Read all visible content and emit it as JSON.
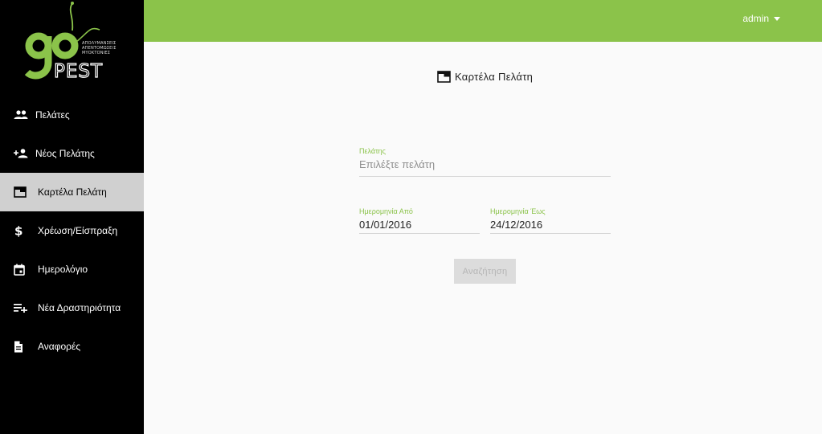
{
  "brand": {
    "logo_name": "go",
    "logo_subtitle_lines": [
      "ΑΠΟΛΥΜΑΝΣΕΙΣ",
      "ΑΠΕΝΤΟΜΩΣΕΙΣ",
      "ΜΥΟΚΤΟΝΙΕΣ"
    ],
    "logo_pest": "PEST",
    "accent_color": "#8bc34a"
  },
  "header": {
    "user_name": "admin"
  },
  "sidebar": {
    "items": [
      {
        "label": "Πελάτες",
        "icon": "people-icon"
      },
      {
        "label": "Νέος Πελάτης",
        "icon": "person-add-icon"
      },
      {
        "label": "Καρτέλα Πελάτη",
        "icon": "tab-card-icon",
        "active": true
      },
      {
        "label": "Χρέωση/Είσπραξη",
        "icon": "dollar-icon"
      },
      {
        "label": "Ημερολόγιο",
        "icon": "calendar-icon"
      },
      {
        "label": "Νέα Δραστηριότητα",
        "icon": "playlist-add-icon"
      },
      {
        "label": "Αναφορές",
        "icon": "document-icon"
      }
    ]
  },
  "main": {
    "title": "Καρτέλα Πελάτη",
    "customer": {
      "label": "Πελάτης",
      "placeholder": "Επιλέξτε πελάτη"
    },
    "date_from": {
      "label": "Ημερομηνία Από",
      "value": "01/01/2016"
    },
    "date_to": {
      "label": "Ημερομηνία Έως",
      "value": "24/12/2016"
    },
    "search_button": "Αναζήτηση"
  }
}
